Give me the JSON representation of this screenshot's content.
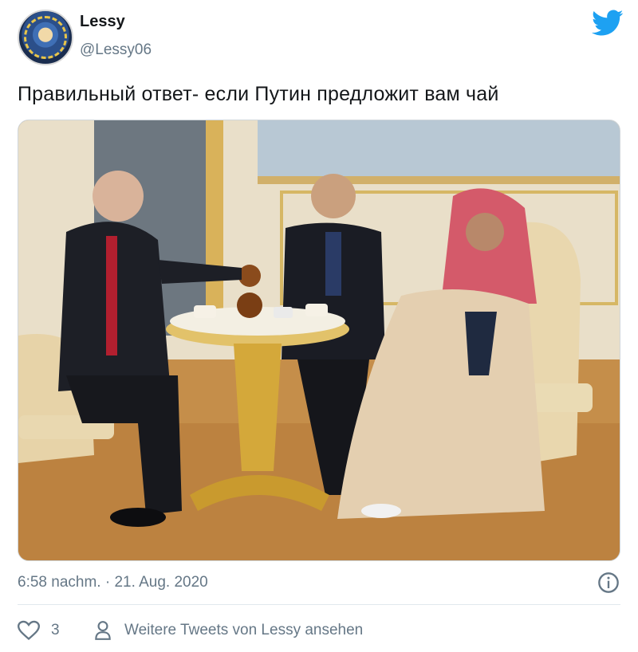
{
  "tweet": {
    "display_name": "Lessy",
    "handle": "@Lessy06",
    "text": "Правильный ответ- если Путин предложит вам чай",
    "timestamp": "6:58 nachm. · 21. Aug. 2020",
    "like_count": "3",
    "more_tweets_label": "Weitere Tweets von Lessy ansehen",
    "photo_icon": "photo-tea-meeting",
    "colors": {
      "brand": "#1DA1F2",
      "text": "#14171a",
      "secondary": "#657786"
    }
  }
}
